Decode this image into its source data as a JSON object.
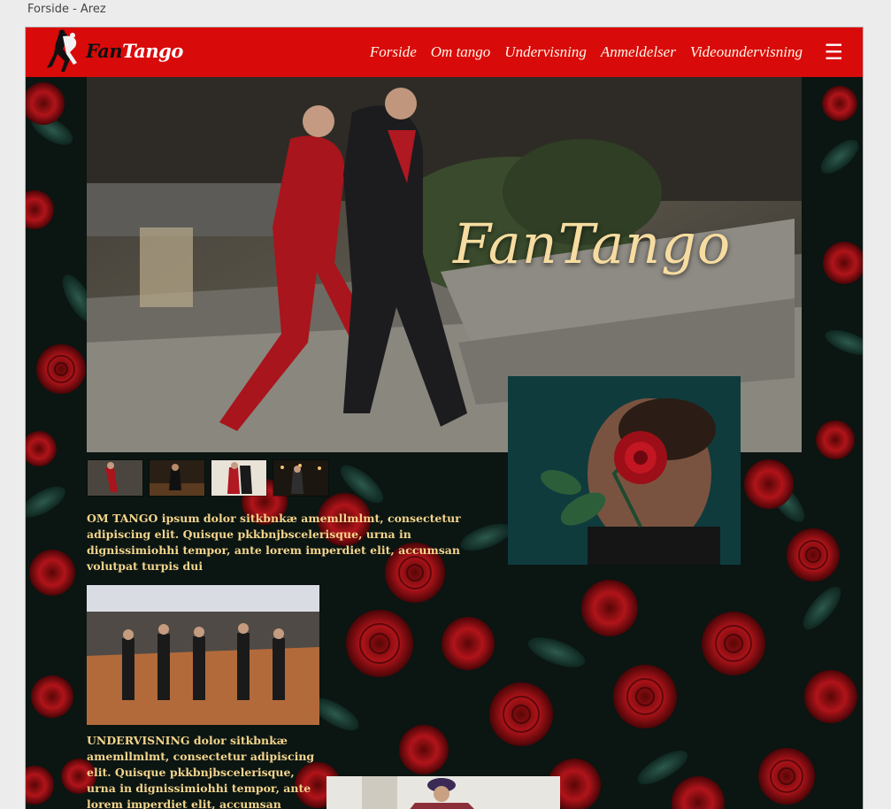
{
  "browser": {
    "tab_title": "Forside - Arez"
  },
  "header": {
    "logo_fan": "Fan",
    "logo_tango": "Tango",
    "nav": [
      "Forside",
      "Om tango",
      "Undervisning",
      "Anmeldelser",
      "Videoundervisning"
    ],
    "menu_icon": "☰"
  },
  "hero": {
    "title": "FanTango"
  },
  "sections": {
    "om_tango": "OM TANGO   ipsum dolor sitkbnkæ amemllmlmt, consectetur adipiscing elit. Quisque pkkbnjbscelerisque, urna in dignissimiohhi tempor, ante lorem imperdiet elit, accumsan volutpat turpis dui",
    "undervisning": "UNDERVISNING dolor sitkbnkæ amemllmlmt, consectetur adipiscing elit. Quisque pkkbnjbscelerisque, urna in dignissimiohhi tempor, ante lorem imperdiet elit, accumsan volutpat"
  },
  "colors": {
    "header_red": "#d90a0a",
    "accent_gold": "#f3d58c",
    "title_gold": "#f6dca0"
  }
}
